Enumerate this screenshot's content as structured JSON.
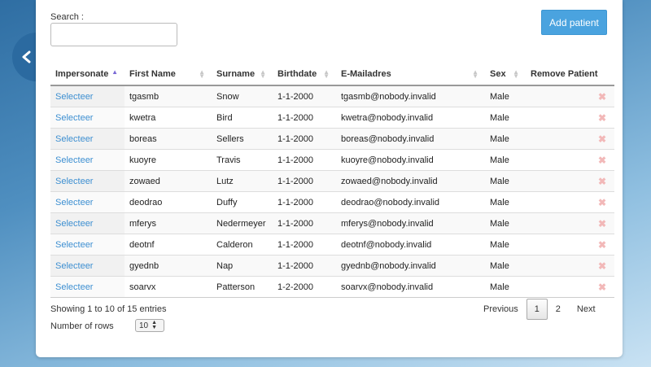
{
  "search": {
    "label": "Search :",
    "value": ""
  },
  "add_button": "Add patient",
  "columns": [
    "Impersonate",
    "First Name",
    "Surname",
    "Birthdate",
    "E-Mailadres",
    "Sex",
    "Remove Patient"
  ],
  "rows": [
    {
      "action": "Selecteer",
      "first": "tgasmb",
      "surname": "Snow",
      "birthdate": "1-1-2000",
      "email": "tgasmb@nobody.invalid",
      "sex": "Male"
    },
    {
      "action": "Selecteer",
      "first": "kwetra",
      "surname": "Bird",
      "birthdate": "1-1-2000",
      "email": "kwetra@nobody.invalid",
      "sex": "Male"
    },
    {
      "action": "Selecteer",
      "first": "boreas",
      "surname": "Sellers",
      "birthdate": "1-1-2000",
      "email": "boreas@nobody.invalid",
      "sex": "Male"
    },
    {
      "action": "Selecteer",
      "first": "kuoyre",
      "surname": "Travis",
      "birthdate": "1-1-2000",
      "email": "kuoyre@nobody.invalid",
      "sex": "Male"
    },
    {
      "action": "Selecteer",
      "first": "zowaed",
      "surname": "Lutz",
      "birthdate": "1-1-2000",
      "email": "zowaed@nobody.invalid",
      "sex": "Male"
    },
    {
      "action": "Selecteer",
      "first": "deodrao",
      "surname": "Duffy",
      "birthdate": "1-1-2000",
      "email": "deodrao@nobody.invalid",
      "sex": "Male"
    },
    {
      "action": "Selecteer",
      "first": "mferys",
      "surname": "Nedermeyer",
      "birthdate": "1-1-2000",
      "email": "mferys@nobody.invalid",
      "sex": "Male"
    },
    {
      "action": "Selecteer",
      "first": "deotnf",
      "surname": "Calderon",
      "birthdate": "1-1-2000",
      "email": "deotnf@nobody.invalid",
      "sex": "Male"
    },
    {
      "action": "Selecteer",
      "first": "gyednb",
      "surname": "Nap",
      "birthdate": "1-1-2000",
      "email": "gyednb@nobody.invalid",
      "sex": "Male"
    },
    {
      "action": "Selecteer",
      "first": "soarvx",
      "surname": "Patterson",
      "birthdate": "1-2-2000",
      "email": "soarvx@nobody.invalid",
      "sex": "Male"
    }
  ],
  "remove_glyph": "✖",
  "info_text": "Showing 1 to 10 of 15 entries",
  "rows_label": "Number of rows",
  "rows_per_page": "10",
  "pagination": {
    "previous": "Previous",
    "pages": [
      "1",
      "2"
    ],
    "current": "1",
    "next": "Next"
  },
  "colors": {
    "accent": "#4aa3df",
    "link": "#3d8fd1",
    "remove": "#f2b8b8",
    "back_button": "#2b6aa0"
  },
  "icons": {
    "back": "chevron-left-icon",
    "sort": "sort-arrows-icon",
    "remove": "close-icon"
  }
}
